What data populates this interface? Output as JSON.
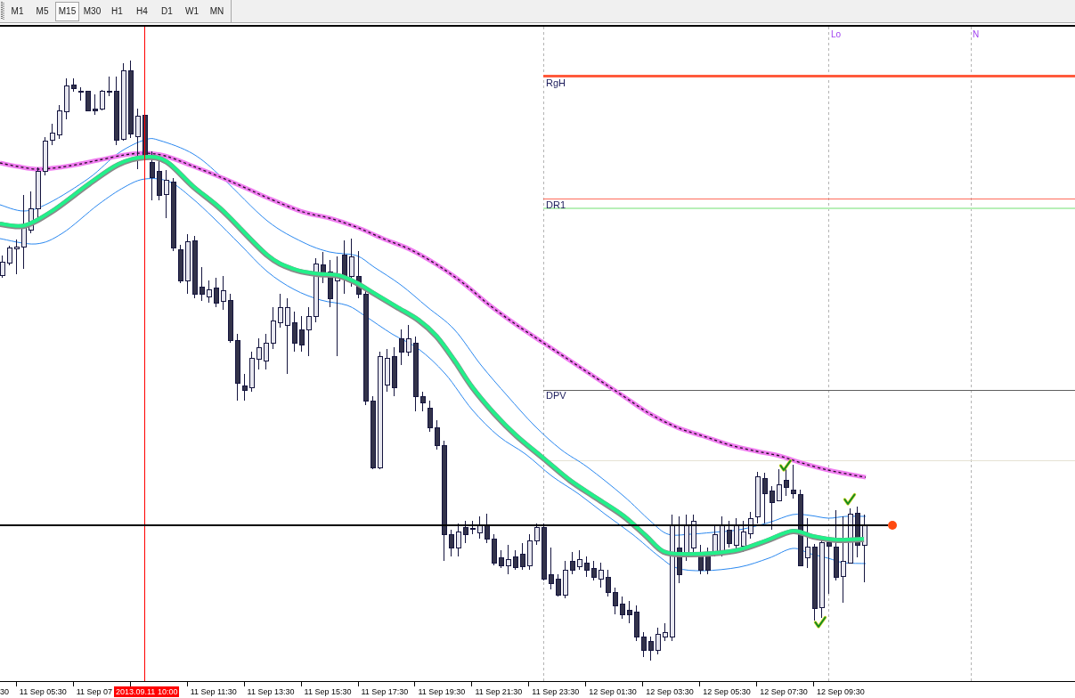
{
  "toolbar": {
    "timeframes": [
      {
        "label": "M1",
        "selected": false
      },
      {
        "label": "M5",
        "selected": false
      },
      {
        "label": "M15",
        "selected": true
      },
      {
        "label": "M30",
        "selected": false
      },
      {
        "label": "H1",
        "selected": false
      },
      {
        "label": "H4",
        "selected": false
      },
      {
        "label": "D1",
        "selected": false
      },
      {
        "label": "W1",
        "selected": false
      },
      {
        "label": "MN",
        "selected": false
      }
    ]
  },
  "chart": {
    "period_labels": [
      "Lo",
      "N"
    ],
    "levels": [
      {
        "label": "RgH",
        "color": "#ff5a3c"
      },
      {
        "label": "DR1",
        "color": "#ff6a5a"
      },
      {
        "label": "DPV",
        "color": "#606060"
      }
    ],
    "time_axis": {
      "labels": [
        "30",
        "11 Sep 05:30",
        "11 Sep 07",
        "11 Sep 11:30",
        "11 Sep 13:30",
        "11 Sep 15:30",
        "11 Sep 17:30",
        "11 Sep 19:30",
        "11 Sep 21:30",
        "11 Sep 23:30",
        "12 Sep 01:30",
        "12 Sep 03:30",
        "12 Sep 05:30",
        "12 Sep 07:30",
        "12 Sep 09:30"
      ],
      "cursor_label": "2013.09.11 10:00"
    }
  }
}
